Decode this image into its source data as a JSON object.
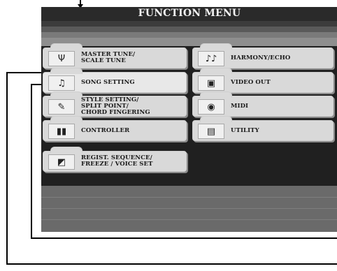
{
  "title": "FUNCTION MENU",
  "menu": {
    "left": [
      {
        "label": "MASTER TUNE/\nSCALE TUNE",
        "icon": "tuning-fork-icon",
        "glyph": "Ψ"
      },
      {
        "label": "SONG SETTING",
        "icon": "music-note-icon",
        "glyph": "♫"
      },
      {
        "label": "STYLE SETTING/\nSPLIT POINT/\nCHORD FINGERING",
        "icon": "style-icon",
        "glyph": "✎"
      },
      {
        "label": "CONTROLLER",
        "icon": "controller-icon",
        "glyph": "▮▮"
      },
      {
        "label": "REGIST. SEQUENCE/\nFREEZE / VOICE SET",
        "icon": "regist-icon",
        "glyph": "◩"
      }
    ],
    "right": [
      {
        "label": "HARMONY/ECHO",
        "icon": "harmony-notes-icon",
        "glyph": "♪♪"
      },
      {
        "label": "VIDEO OUT",
        "icon": "video-monitor-icon",
        "glyph": "▣"
      },
      {
        "label": "MIDI",
        "icon": "midi-connector-icon",
        "glyph": "◉"
      },
      {
        "label": "UTILITY",
        "icon": "utility-computer-icon",
        "glyph": "▤"
      }
    ]
  }
}
